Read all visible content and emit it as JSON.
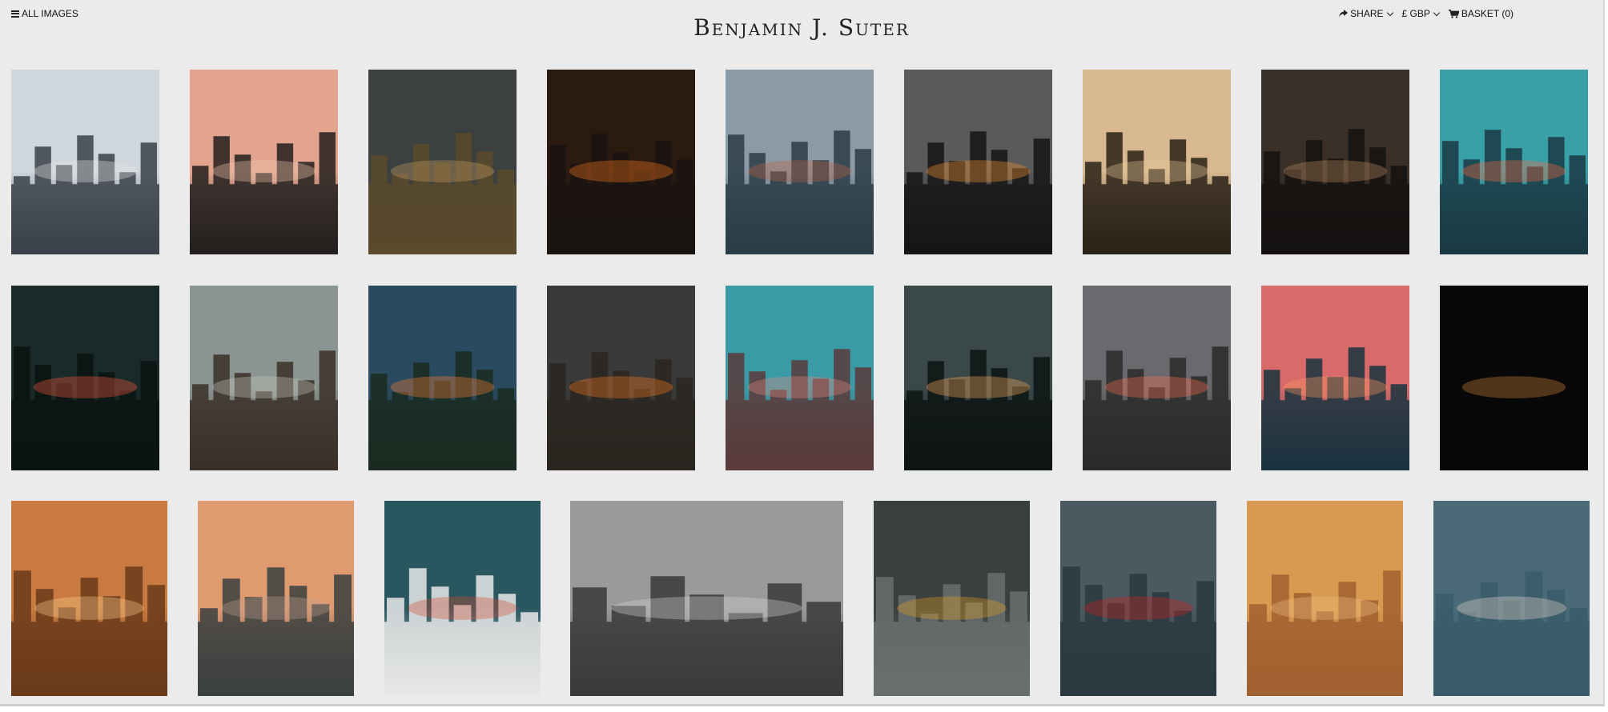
{
  "header": {
    "all_images_label": "ALL IMAGES",
    "title": "Benjamin J. Suter",
    "share_label": "SHARE",
    "currency_label": "£ GBP",
    "basket_label": "BASKET (0)"
  },
  "icons": {
    "menu": "hamburger-icon",
    "share": "share-arrow-icon",
    "basket": "shopping-cart-icon",
    "dropdown": "chevron-down-icon"
  },
  "gallery": [
    {
      "name": "photo-chicago-skyline-stadium",
      "sky": "#cfd6dc",
      "ground": "#3a4149",
      "accent": "#e8e8e8"
    },
    {
      "name": "photo-city-towers-pink-sky",
      "sky": "#e3a48e",
      "ground": "#23201f",
      "accent": "#f0c8b0"
    },
    {
      "name": "photo-prairie-storm-road",
      "sky": "#3c4040",
      "ground": "#5a4a2c",
      "accent": "#c8a060"
    },
    {
      "name": "photo-sunset-street-canyon",
      "sky": "#2a1a10",
      "ground": "#1a1410",
      "accent": "#ff7a20"
    },
    {
      "name": "photo-lake-waves-skyline",
      "sky": "#8a9aa6",
      "ground": "#2a3c46",
      "accent": "#c06040"
    },
    {
      "name": "photo-train-tracks-night",
      "sky": "#5a5a5a",
      "ground": "#151515",
      "accent": "#ff9a30"
    },
    {
      "name": "photo-golden-hour-tower",
      "sky": "#d8b890",
      "ground": "#2a2218",
      "accent": "#e8c898"
    },
    {
      "name": "photo-dark-alley-buildings",
      "sky": "#3a3028",
      "ground": "#141210",
      "accent": "#c09060"
    },
    {
      "name": "photo-skyline-lake-teal",
      "sky": "#3aa0a8",
      "ground": "#1a3a44",
      "accent": "#ff6a40"
    },
    {
      "name": "photo-train-station-platform",
      "sky": "#1a2a28",
      "ground": "#0a1412",
      "accent": "#ff5a40"
    },
    {
      "name": "photo-mountain-coast",
      "sky": "#8a9490",
      "ground": "#3a3028",
      "accent": "#c8c8c0"
    },
    {
      "name": "photo-bridge-cables-city",
      "sky": "#2a4a60",
      "ground": "#1a2a20",
      "accent": "#ff8030"
    },
    {
      "name": "photo-lake-pier-sunset",
      "sky": "#3a3a3a",
      "ground": "#2a2620",
      "accent": "#ff7a20"
    },
    {
      "name": "photo-fairytale-castle",
      "sky": "#3a9aa6",
      "ground": "#5a3a3a",
      "accent": "#e88a80"
    },
    {
      "name": "photo-night-city-river",
      "sky": "#3a4848",
      "ground": "#0e1414",
      "accent": "#ffb060"
    },
    {
      "name": "photo-water-tower-skyline",
      "sky": "#6a6a6e",
      "ground": "#2a2a2a",
      "accent": "#ff7050"
    },
    {
      "name": "photo-pink-sunset-skyline",
      "sky": "#d86a6a",
      "ground": "#1a3440",
      "accent": "#ff9a60"
    },
    {
      "name": "photo-full-moon-night",
      "sky": "#080808",
      "ground": "#080808",
      "accent": "#d88a40"
    },
    {
      "name": "photo-fog-sunrise-tower",
      "sky": "#c87a40",
      "ground": "#6a3a1a",
      "accent": "#ffd090"
    },
    {
      "name": "photo-fog-birds-city",
      "sky": "#e09a70",
      "ground": "#3a4040",
      "accent": "#c0a090"
    },
    {
      "name": "photo-cross-snow-teal",
      "sky": "#2a5660",
      "ground": "#e8e8e8",
      "accent": "#d04a30"
    },
    {
      "name": "photo-fog-city-monochrome",
      "sky": "#9a9a9a",
      "ground": "#3a3a3a",
      "accent": "#d8d8d8"
    },
    {
      "name": "photo-aerial-bridge-yellow",
      "sky": "#3a4040",
      "ground": "#6a7070",
      "accent": "#e8a020"
    },
    {
      "name": "photo-red-lighthouse-waves",
      "sky": "#4a5a60",
      "ground": "#2a3a40",
      "accent": "#d02020"
    },
    {
      "name": "photo-fog-orange-tower",
      "sky": "#d89a50",
      "ground": "#a06030",
      "accent": "#f0c080"
    },
    {
      "name": "photo-ice-lighthouse",
      "sky": "#4a6a78",
      "ground": "#3a5a68",
      "accent": "#e8d8c8"
    }
  ]
}
